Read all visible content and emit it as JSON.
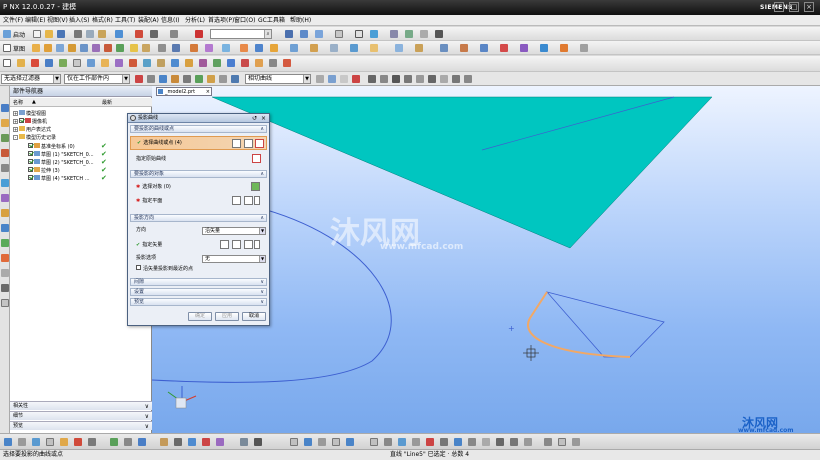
{
  "app": {
    "title": "NX 12.0.0.27 - 建模",
    "brand": "SIEMENS",
    "title_prefix": "P"
  },
  "menus": [
    "文件(F)",
    "编辑(E)",
    "视图(V)",
    "插入(S)",
    "格式(R)",
    "工具(T)",
    "装配(A)",
    "信息(I)",
    "分析(L)",
    "首选项(P)",
    "窗口(O)",
    "GC工具箱",
    "帮助(H)"
  ],
  "toolbar1": {
    "start_label": "启动"
  },
  "toolbar2": {
    "sketch_label": "草图"
  },
  "selection": {
    "filter": "无选择过滤器",
    "scope": "仅在工作部件内",
    "curve_rule": "相切曲线"
  },
  "part_navigator": {
    "title": "部件导航器",
    "col_name": "名称",
    "col_recent": "最新",
    "items": [
      {
        "label": "模型视图"
      },
      {
        "label": "摄像机"
      },
      {
        "label": "用户表达式"
      },
      {
        "label": "模型历史记录"
      },
      {
        "label": "基准坐标系 (0)",
        "check": "✔"
      },
      {
        "label": "草图 (1) \"SKETCH_0...",
        "check": "✔"
      },
      {
        "label": "草图 (2) \"SKETCH_0...",
        "check": "✔"
      },
      {
        "label": "拉伸 (3)",
        "check": "✔"
      },
      {
        "label": "草图 (4) \"SKETCH ...",
        "check": "✔"
      }
    ],
    "sections": [
      "相关性",
      "细节",
      "预览"
    ]
  },
  "viewport": {
    "tab_label": "_model2.prt"
  },
  "dialog": {
    "title": "投影曲线",
    "group1": "要投影的曲线或点",
    "select_curve": "选择曲线或点 (4)",
    "specify_origin": "指定原始曲线",
    "group2": "要投影的对象",
    "select_object": "选择对象 (0)",
    "specify_plane": "指定平面",
    "group3": "投影方向",
    "direction_label": "方向",
    "direction_value": "沿矢量",
    "specify_vector": "指定矢量",
    "projection_option_label": "投影选项",
    "projection_option_value": "无",
    "nearest_point_label": "沿矢量投影到最近的点",
    "group4": "间隙",
    "group5": "设置",
    "group6": "预览",
    "ok": "确定",
    "apply": "应用",
    "cancel": "取消"
  },
  "status": {
    "left": "选择要投影的曲线或点",
    "middle": "直线 \"Line5\" 已选定 · 总数 4"
  },
  "watermark": {
    "text_cn": "沐风网",
    "text_url": "www.mfcad.com"
  },
  "colors": {
    "accent": "#00c6c0",
    "highlight": "#f2a865",
    "curve": "#3d5fd0"
  }
}
